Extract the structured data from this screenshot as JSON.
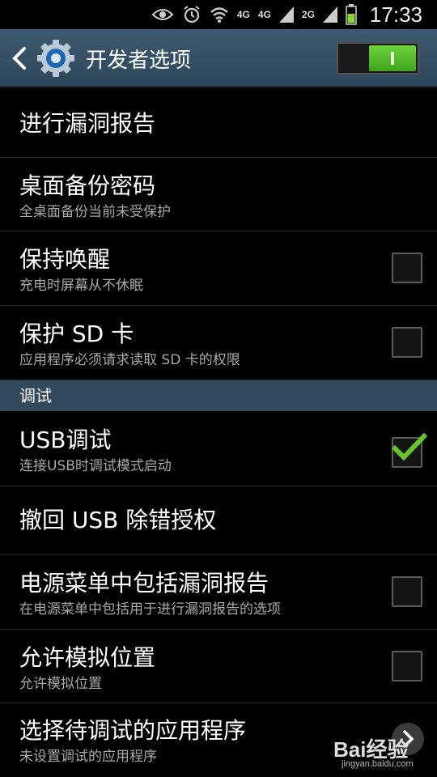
{
  "status_bar": {
    "network_1": "4G",
    "network_2": "4G",
    "network_3": "2G",
    "time": "17:33"
  },
  "action_bar": {
    "title": "开发者选项",
    "master_switch_on": true
  },
  "items": [
    {
      "title": "进行漏洞报告",
      "subtitle": ""
    },
    {
      "title": "桌面备份密码",
      "subtitle": "全桌面备份当前未受保护"
    },
    {
      "title": "保持唤醒",
      "subtitle": "充电时屏幕从不休眠",
      "checked": false
    },
    {
      "title": "保护 SD 卡",
      "subtitle": "应用程序必须请求读取 SD 卡的权限",
      "checked": false
    }
  ],
  "section": {
    "label": "调试"
  },
  "debug_items": [
    {
      "title": "USB调试",
      "subtitle": "连接USB时调试模式启动",
      "checked": true
    },
    {
      "title": "撤回 USB 除错授权",
      "subtitle": ""
    },
    {
      "title": "电源菜单中包括漏洞报告",
      "subtitle": "在电源菜单中包括用于进行漏洞报告的选项",
      "checked": false
    },
    {
      "title": "允许模拟位置",
      "subtitle": "允许模拟位置",
      "checked": false
    },
    {
      "title": "选择待调试的应用程序",
      "subtitle": "未设置调试的应用程序"
    }
  ],
  "watermark": {
    "logo": "Bai经验",
    "url": "jingyan.baidu.com"
  },
  "colors": {
    "accent_green": "#4cb82a",
    "header_blue": "#324a5c"
  }
}
